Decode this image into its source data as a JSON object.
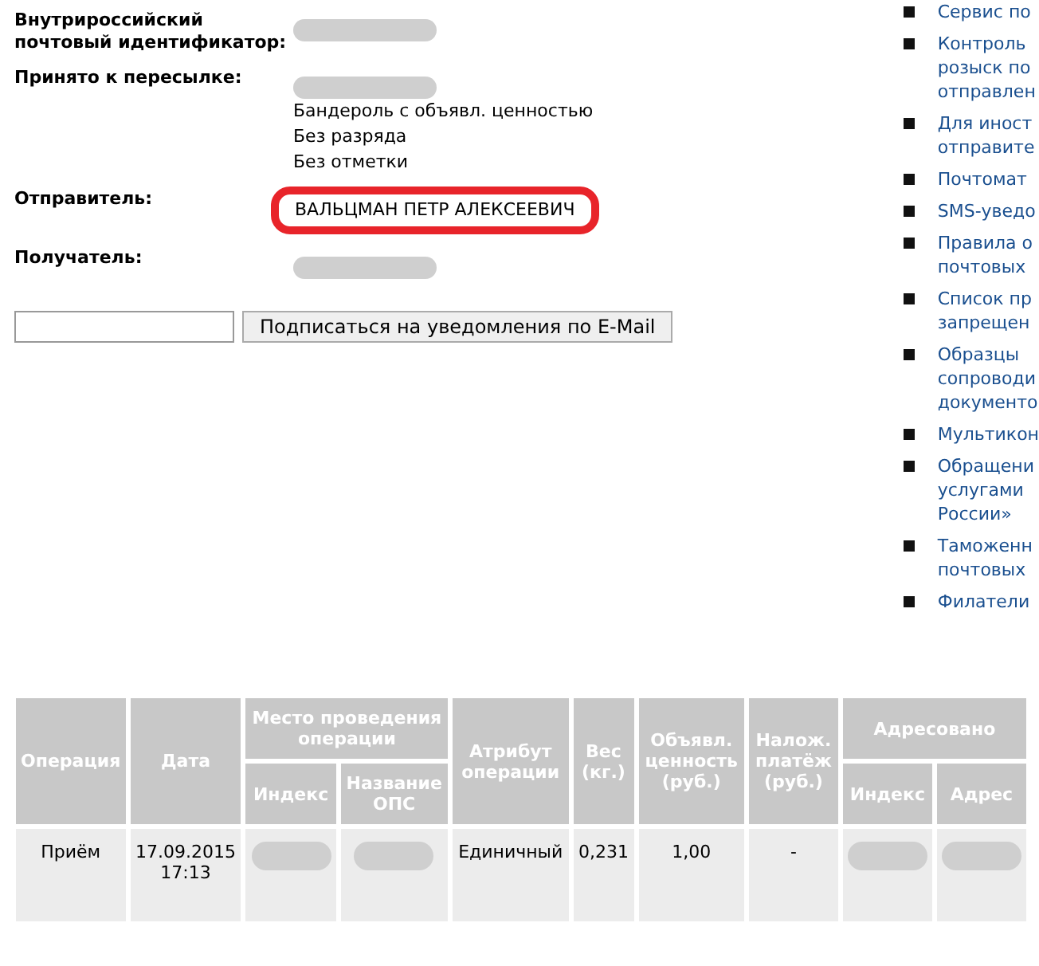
{
  "details": [
    {
      "label": "Внутрироссийский почтовый идентификатор:",
      "redacted": true
    },
    {
      "label": "Принято к пересылке:",
      "values": [
        "Бандероль с объявл. ценностью",
        "Без разряда",
        "Без отметки"
      ],
      "redacted": true,
      "highlighted": false
    },
    {
      "label": "Отправитель:",
      "values": [
        "ВАЛЬЦМАН ПЕТР АЛЕКСЕЕВИЧ"
      ],
      "redacted": false,
      "highlighted": true
    },
    {
      "label": "Получатель:",
      "redacted": true
    }
  ],
  "subscribe": {
    "button": "Подписаться на уведомления по E-Mail"
  },
  "sidebar": {
    "items": [
      {
        "lines": [
          "Сервис по"
        ]
      },
      {
        "lines": [
          "Контроль",
          "розыск по",
          "отправлен"
        ]
      },
      {
        "lines": [
          "Для иност",
          "отправите"
        ]
      },
      {
        "lines": [
          "Почтомат"
        ]
      },
      {
        "lines": [
          "SMS-уведо"
        ]
      },
      {
        "lines": [
          "Правила о",
          "почтовых"
        ]
      },
      {
        "lines": [
          "Список пр",
          "запрещен"
        ]
      },
      {
        "lines": [
          "Образцы",
          "сопроводи",
          "документо"
        ]
      },
      {
        "lines": [
          "Мультикон"
        ]
      },
      {
        "lines": [
          "Обращени",
          "услугами",
          "России»"
        ]
      },
      {
        "lines": [
          "Таможенн",
          "почтовых"
        ]
      },
      {
        "lines": [
          "Филатели"
        ]
      }
    ]
  },
  "table": {
    "header_top": [
      "Операция",
      "Дата",
      "Место проведения операции",
      "Атрибут операции",
      "Вес (кг.)",
      "Объявл. ценность (руб.)",
      "Налож. платёж (руб.)",
      "Адресовано"
    ],
    "header_sub": [
      "Индекс",
      "Название ОПС",
      "Индекс",
      "Адрес"
    ],
    "rows": [
      {
        "cells": [
          {
            "text": "Приём",
            "redacted": false
          },
          {
            "text": "17.09.2015 17:13",
            "redacted": false
          },
          {
            "redacted": true
          },
          {
            "redacted": true
          },
          {
            "text": "Единичный",
            "redacted": false
          },
          {
            "text": "0,231",
            "redacted": false
          },
          {
            "text": "1,00",
            "redacted": false
          },
          {
            "text": "-",
            "redacted": false
          },
          {
            "redacted": true
          },
          {
            "redacted": true
          }
        ]
      }
    ]
  }
}
